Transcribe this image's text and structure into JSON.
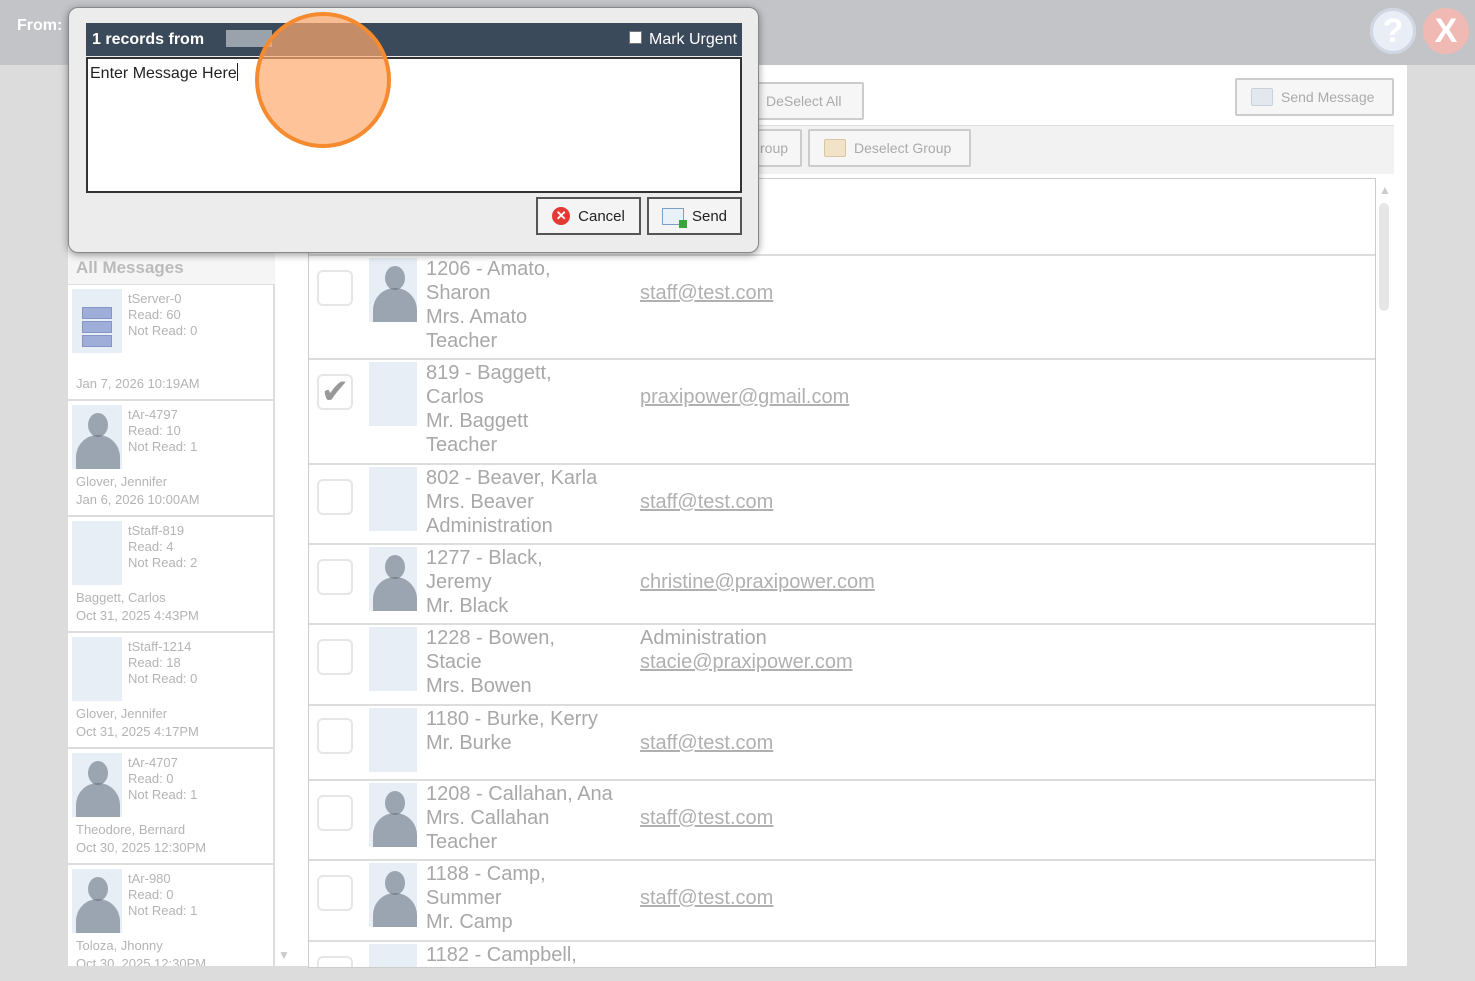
{
  "header": {
    "from_label": "From:",
    "help_glyph": "?",
    "close_glyph": "X"
  },
  "toolbar": {
    "deselect_all": "DeSelect All",
    "send_message": "Send Message",
    "select_group_partial": "roup",
    "deselect_group": "Deselect Group"
  },
  "sidebar": {
    "title": "All Messages",
    "items": [
      {
        "id": "tServer-0",
        "read": "Read: 60",
        "not_read": "Not Read: 0",
        "name": "",
        "date": "Jan 7, 2026 10:19AM",
        "icon": "server-icon"
      },
      {
        "id": "tAr-4797",
        "read": "Read: 10",
        "not_read": "Not Read: 1",
        "name": "Glover, Jennifer",
        "date": "Jan 6, 2026 10:00AM",
        "icon": "silhouette"
      },
      {
        "id": "tStaff-819",
        "read": "Read: 4",
        "not_read": "Not Read: 2",
        "name": "Baggett, Carlos",
        "date": "Oct 31, 2025 4:43PM",
        "icon": "photo"
      },
      {
        "id": "tStaff-1214",
        "read": "Read: 18",
        "not_read": "Not Read: 0",
        "name": "Glover, Jennifer",
        "date": "Oct 31, 2025 4:17PM",
        "icon": "photo"
      },
      {
        "id": "tAr-4707",
        "read": "Read: 0",
        "not_read": "Not Read: 1",
        "name": "Theodore, Bernard",
        "date": "Oct 30, 2025 12:30PM",
        "icon": "silhouette"
      },
      {
        "id": "tAr-980",
        "read": "Read: 0",
        "not_read": "Not Read: 1",
        "name": "Toloza, Jhonny",
        "date": "Oct 30, 2025 12:30PM",
        "icon": "silhouette"
      }
    ]
  },
  "recipients": [
    {
      "name_lines": [
        "1206 - Amato,",
        "Sharon",
        "Mrs. Amato",
        "Teacher"
      ],
      "extra": "",
      "email": "staff@test.com",
      "checked": false
    },
    {
      "name_lines": [
        "819 - Baggett,",
        "Carlos",
        "Mr. Baggett",
        "Teacher"
      ],
      "extra": "",
      "email": "praxipower@gmail.com",
      "checked": true
    },
    {
      "name_lines": [
        "802 - Beaver, Karla",
        "Mrs. Beaver",
        "Administration"
      ],
      "extra": "",
      "email": "staff@test.com",
      "checked": false
    },
    {
      "name_lines": [
        "1277 - Black,",
        "Jeremy",
        "Mr. Black"
      ],
      "extra": "",
      "email": "christine@praxipower.com",
      "checked": false
    },
    {
      "name_lines": [
        "1228 - Bowen,",
        "Stacie",
        "Mrs. Bowen"
      ],
      "extra": "Administration",
      "email": "stacie@praxipower.com",
      "checked": false
    },
    {
      "name_lines": [
        "1180 - Burke, Kerry",
        "Mr. Burke"
      ],
      "extra": "",
      "email": "staff@test.com",
      "checked": false
    },
    {
      "name_lines": [
        "1208 - Callahan, Ana",
        "Mrs. Callahan",
        "Teacher"
      ],
      "extra": "",
      "email": "staff@test.com",
      "checked": false
    },
    {
      "name_lines": [
        "1188 - Camp,",
        "Summer",
        "Mr. Camp"
      ],
      "extra": "",
      "email": "staff@test.com",
      "checked": false
    },
    {
      "name_lines": [
        "1182 - Campbell,"
      ],
      "extra": "",
      "email": "",
      "checked": false
    }
  ],
  "dialog": {
    "title": "1 records from",
    "mark_urgent": "Mark Urgent",
    "message": "Enter Message Here",
    "cancel": "Cancel",
    "send": "Send",
    "cancel_glyph": "✕"
  },
  "checkmark_glyph": "✔",
  "scroll_up_glyph": "▲",
  "scroll_down_glyph": "▼"
}
